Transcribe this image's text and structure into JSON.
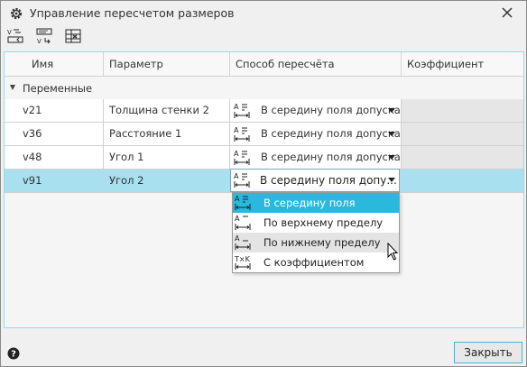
{
  "window": {
    "title": "Управление пересчетом размеров",
    "icons": [
      "gear-icon",
      "close-icon"
    ]
  },
  "toolbar": {
    "buttons": [
      "recalc-variables-icon",
      "recalc-apply-icon",
      "table-settings-icon"
    ]
  },
  "table": {
    "columns": [
      "Имя",
      "Параметр",
      "Способ пересчёта",
      "Коэффициент"
    ],
    "group": "Переменные",
    "rows": [
      {
        "name": "v21",
        "param": "Толщина стенки 2",
        "method": "В середину поля допуска",
        "coef": ""
      },
      {
        "name": "v36",
        "param": "Расстояние 1",
        "method": "В середину поля допуска",
        "coef": ""
      },
      {
        "name": "v48",
        "param": "Угол 1",
        "method": "В середину поля допуска",
        "coef": ""
      },
      {
        "name": "v91",
        "param": "Угол 2",
        "method": "В середину поля допу...",
        "coef": ""
      }
    ],
    "selected_row": 3
  },
  "dropdown": {
    "options": [
      {
        "label": "В середину поля допуска",
        "icon": "tolerance-middle-icon",
        "state": "selected"
      },
      {
        "label": "По верхнему пределу",
        "icon": "tolerance-upper-icon",
        "state": ""
      },
      {
        "label": "По нижнему пределу",
        "icon": "tolerance-lower-icon",
        "state": "hover"
      },
      {
        "label": "С коэффициентом",
        "icon": "coefficient-icon",
        "state": ""
      }
    ]
  },
  "footer": {
    "help_icon": "help-icon",
    "close_label": "Закрыть"
  },
  "colors": {
    "selection": "#a8e0f0",
    "accent": "#2ab8dc",
    "coef_disabled": "#e6e6e6"
  }
}
